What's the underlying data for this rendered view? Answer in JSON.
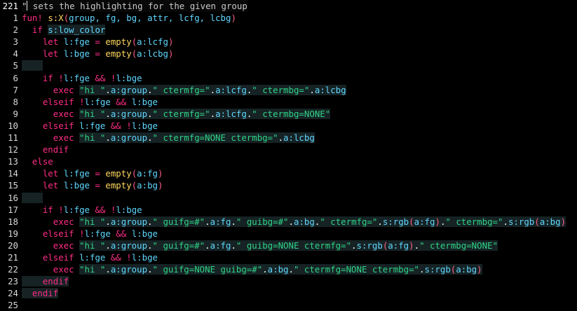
{
  "editor": {
    "current_line_number": "221",
    "colors": {
      "background": "#000000",
      "comment": "#c9c9c9",
      "keyword": "#ff2d86",
      "function": "#ffd75f",
      "variable": "#5fd7ff",
      "string": "#2ed486",
      "highlight_bg": "#162224"
    },
    "lines": [
      {
        "num": "221",
        "tokens": [
          {
            "t": "\"",
            "c": "c-comment"
          },
          {
            "t": " sets the highlighting for the given group",
            "c": "c-comment"
          }
        ]
      },
      {
        "num": "1",
        "tokens": [
          {
            "t": "fun! ",
            "c": "c-kw"
          },
          {
            "t": "s:X",
            "c": "c-fn"
          },
          {
            "t": "(",
            "c": "c-paren"
          },
          {
            "t": "group, fg, bg, attr, lcfg, lcbg",
            "c": "c-var"
          },
          {
            "t": ")",
            "c": "c-paren"
          }
        ]
      },
      {
        "num": "2",
        "tokens": [
          {
            "t": "  if ",
            "c": "c-kw"
          },
          {
            "t": "s:low_color",
            "c": "c-var",
            "hl": true
          }
        ]
      },
      {
        "num": "3",
        "tokens": [
          {
            "t": "    let ",
            "c": "c-kw"
          },
          {
            "t": "l:fge",
            "c": "c-var"
          },
          {
            "t": " = ",
            "c": "c-op"
          },
          {
            "t": "empty",
            "c": "c-fn"
          },
          {
            "t": "(",
            "c": "c-paren"
          },
          {
            "t": "a:lcfg",
            "c": "c-var"
          },
          {
            "t": ")",
            "c": "c-paren"
          }
        ]
      },
      {
        "num": "4",
        "tokens": [
          {
            "t": "    let ",
            "c": "c-kw"
          },
          {
            "t": "l:bge",
            "c": "c-var"
          },
          {
            "t": " = ",
            "c": "c-op"
          },
          {
            "t": "empty",
            "c": "c-fn"
          },
          {
            "t": "(",
            "c": "c-paren"
          },
          {
            "t": "a:lcbg",
            "c": "c-var"
          },
          {
            "t": ")",
            "c": "c-paren"
          }
        ]
      },
      {
        "num": "5",
        "tokens": [
          {
            "t": "    ",
            "c": "c-punc",
            "hl": true
          }
        ]
      },
      {
        "num": "6",
        "tokens": [
          {
            "t": "    if ",
            "c": "c-kw"
          },
          {
            "t": "!",
            "c": "c-op"
          },
          {
            "t": "l:fge",
            "c": "c-var"
          },
          {
            "t": " && ",
            "c": "c-op"
          },
          {
            "t": "!",
            "c": "c-op"
          },
          {
            "t": "l:bge",
            "c": "c-var"
          }
        ]
      },
      {
        "num": "7",
        "tokens": [
          {
            "t": "      exec ",
            "c": "c-kw"
          },
          {
            "t": "\"hi \"",
            "c": "c-str",
            "hl": true
          },
          {
            "t": ".",
            "c": "c-punc",
            "hl": true
          },
          {
            "t": "a:group",
            "c": "c-var",
            "hl": true
          },
          {
            "t": ".",
            "c": "c-punc",
            "hl": true
          },
          {
            "t": "\" ctermfg=\"",
            "c": "c-str",
            "hl": true
          },
          {
            "t": ".",
            "c": "c-punc",
            "hl": true
          },
          {
            "t": "a:lcfg",
            "c": "c-var",
            "hl": true
          },
          {
            "t": ".",
            "c": "c-punc",
            "hl": true
          },
          {
            "t": "\" ctermbg=\"",
            "c": "c-str",
            "hl": true
          },
          {
            "t": ".",
            "c": "c-punc",
            "hl": true
          },
          {
            "t": "a:lcbg",
            "c": "c-var",
            "hl": true
          }
        ]
      },
      {
        "num": "8",
        "tokens": [
          {
            "t": "    elseif ",
            "c": "c-kw"
          },
          {
            "t": "!",
            "c": "c-op"
          },
          {
            "t": "l:fge",
            "c": "c-var"
          },
          {
            "t": " && ",
            "c": "c-op"
          },
          {
            "t": "l:bge",
            "c": "c-var"
          }
        ]
      },
      {
        "num": "9",
        "tokens": [
          {
            "t": "      exec ",
            "c": "c-kw"
          },
          {
            "t": "\"hi \"",
            "c": "c-str",
            "hl": true
          },
          {
            "t": ".",
            "c": "c-punc",
            "hl": true
          },
          {
            "t": "a:group",
            "c": "c-var",
            "hl": true
          },
          {
            "t": ".",
            "c": "c-punc",
            "hl": true
          },
          {
            "t": "\" ctermfg=\"",
            "c": "c-str",
            "hl": true
          },
          {
            "t": ".",
            "c": "c-punc",
            "hl": true
          },
          {
            "t": "a:lcfg",
            "c": "c-var",
            "hl": true
          },
          {
            "t": ".",
            "c": "c-punc",
            "hl": true
          },
          {
            "t": "\" ctermbg=NONE\"",
            "c": "c-str",
            "hl": true
          }
        ]
      },
      {
        "num": "10",
        "tokens": [
          {
            "t": "    elseif ",
            "c": "c-kw"
          },
          {
            "t": "l:fge",
            "c": "c-var"
          },
          {
            "t": " && ",
            "c": "c-op"
          },
          {
            "t": "!",
            "c": "c-op"
          },
          {
            "t": "l:bge",
            "c": "c-var"
          }
        ]
      },
      {
        "num": "11",
        "tokens": [
          {
            "t": "      exec ",
            "c": "c-kw"
          },
          {
            "t": "\"hi \"",
            "c": "c-str",
            "hl": true
          },
          {
            "t": ".",
            "c": "c-punc",
            "hl": true
          },
          {
            "t": "a:group",
            "c": "c-var",
            "hl": true
          },
          {
            "t": ".",
            "c": "c-punc",
            "hl": true
          },
          {
            "t": "\" ctermfg=NONE ctermbg=\"",
            "c": "c-str",
            "hl": true
          },
          {
            "t": ".",
            "c": "c-punc",
            "hl": true
          },
          {
            "t": "a:lcbg",
            "c": "c-var",
            "hl": true
          }
        ]
      },
      {
        "num": "12",
        "tokens": [
          {
            "t": "    endif",
            "c": "c-kw"
          }
        ]
      },
      {
        "num": "13",
        "tokens": [
          {
            "t": "  else",
            "c": "c-kw"
          }
        ]
      },
      {
        "num": "14",
        "tokens": [
          {
            "t": "    let ",
            "c": "c-kw"
          },
          {
            "t": "l:fge",
            "c": "c-var"
          },
          {
            "t": " = ",
            "c": "c-op"
          },
          {
            "t": "empty",
            "c": "c-fn"
          },
          {
            "t": "(",
            "c": "c-paren"
          },
          {
            "t": "a:fg",
            "c": "c-var"
          },
          {
            "t": ")",
            "c": "c-paren"
          }
        ]
      },
      {
        "num": "15",
        "tokens": [
          {
            "t": "    let ",
            "c": "c-kw"
          },
          {
            "t": "l:bge",
            "c": "c-var"
          },
          {
            "t": " = ",
            "c": "c-op"
          },
          {
            "t": "empty",
            "c": "c-fn"
          },
          {
            "t": "(",
            "c": "c-paren"
          },
          {
            "t": "a:bg",
            "c": "c-var"
          },
          {
            "t": ")",
            "c": "c-paren"
          }
        ]
      },
      {
        "num": "16",
        "tokens": [
          {
            "t": "    ",
            "c": "c-punc",
            "hl": true
          }
        ]
      },
      {
        "num": "17",
        "tokens": [
          {
            "t": "    if ",
            "c": "c-kw"
          },
          {
            "t": "!",
            "c": "c-op"
          },
          {
            "t": "l:fge",
            "c": "c-var"
          },
          {
            "t": " && ",
            "c": "c-op"
          },
          {
            "t": "!",
            "c": "c-op"
          },
          {
            "t": "l:bge",
            "c": "c-var"
          }
        ]
      },
      {
        "num": "18",
        "tokens": [
          {
            "t": "      exec ",
            "c": "c-kw"
          },
          {
            "t": "\"hi \"",
            "c": "c-str",
            "hl": true
          },
          {
            "t": ".",
            "c": "c-punc",
            "hl": true
          },
          {
            "t": "a:group",
            "c": "c-var",
            "hl": true
          },
          {
            "t": ".",
            "c": "c-punc",
            "hl": true
          },
          {
            "t": "\" guifg=#\"",
            "c": "c-str",
            "hl": true
          },
          {
            "t": ".",
            "c": "c-punc",
            "hl": true
          },
          {
            "t": "a:fg",
            "c": "c-var",
            "hl": true
          },
          {
            "t": ".",
            "c": "c-punc",
            "hl": true
          },
          {
            "t": "\" guibg=#\"",
            "c": "c-str",
            "hl": true
          },
          {
            "t": ".",
            "c": "c-punc",
            "hl": true
          },
          {
            "t": "a:bg",
            "c": "c-var",
            "hl": true
          },
          {
            "t": ".",
            "c": "c-punc",
            "hl": true
          },
          {
            "t": "\" ctermfg=\"",
            "c": "c-str",
            "hl": true
          },
          {
            "t": ".",
            "c": "c-punc",
            "hl": true
          },
          {
            "t": "s:rgb",
            "c": "c-var",
            "hl": true
          },
          {
            "t": "(",
            "c": "c-paren",
            "hl": true
          },
          {
            "t": "a:fg",
            "c": "c-var",
            "hl": true
          },
          {
            "t": ")",
            "c": "c-paren",
            "hl": true
          },
          {
            "t": ".",
            "c": "c-punc",
            "hl": true
          },
          {
            "t": "\" ctermbg=\"",
            "c": "c-str",
            "hl": true
          },
          {
            "t": ".",
            "c": "c-punc",
            "hl": true
          },
          {
            "t": "s:rgb",
            "c": "c-var",
            "hl": true
          },
          {
            "t": "(",
            "c": "c-paren",
            "hl": true
          },
          {
            "t": "a:bg",
            "c": "c-var",
            "hl": true
          },
          {
            "t": ")",
            "c": "c-paren",
            "hl": true
          }
        ]
      },
      {
        "num": "19",
        "tokens": [
          {
            "t": "    elseif ",
            "c": "c-kw"
          },
          {
            "t": "!",
            "c": "c-op"
          },
          {
            "t": "l:fge",
            "c": "c-var"
          },
          {
            "t": " && ",
            "c": "c-op"
          },
          {
            "t": "l:bge",
            "c": "c-var"
          }
        ]
      },
      {
        "num": "20",
        "tokens": [
          {
            "t": "      exec ",
            "c": "c-kw"
          },
          {
            "t": "\"hi \"",
            "c": "c-str",
            "hl": true
          },
          {
            "t": ".",
            "c": "c-punc",
            "hl": true
          },
          {
            "t": "a:group",
            "c": "c-var",
            "hl": true
          },
          {
            "t": ".",
            "c": "c-punc",
            "hl": true
          },
          {
            "t": "\" guifg=#\"",
            "c": "c-str",
            "hl": true
          },
          {
            "t": ".",
            "c": "c-punc",
            "hl": true
          },
          {
            "t": "a:fg",
            "c": "c-var",
            "hl": true
          },
          {
            "t": ".",
            "c": "c-punc",
            "hl": true
          },
          {
            "t": "\" guibg=NONE ctermfg=\"",
            "c": "c-str",
            "hl": true
          },
          {
            "t": ".",
            "c": "c-punc",
            "hl": true
          },
          {
            "t": "s:rgb",
            "c": "c-var",
            "hl": true
          },
          {
            "t": "(",
            "c": "c-paren",
            "hl": true
          },
          {
            "t": "a:fg",
            "c": "c-var",
            "hl": true
          },
          {
            "t": ")",
            "c": "c-paren",
            "hl": true
          },
          {
            "t": ".",
            "c": "c-punc",
            "hl": true
          },
          {
            "t": "\" ctermbg=NONE\"",
            "c": "c-str",
            "hl": true
          }
        ]
      },
      {
        "num": "21",
        "tokens": [
          {
            "t": "    elseif ",
            "c": "c-kw"
          },
          {
            "t": "l:fge",
            "c": "c-var"
          },
          {
            "t": " && ",
            "c": "c-op"
          },
          {
            "t": "!",
            "c": "c-op"
          },
          {
            "t": "l:bge",
            "c": "c-var"
          }
        ]
      },
      {
        "num": "22",
        "tokens": [
          {
            "t": "      exec ",
            "c": "c-kw"
          },
          {
            "t": "\"hi \"",
            "c": "c-str",
            "hl": true
          },
          {
            "t": ".",
            "c": "c-punc",
            "hl": true
          },
          {
            "t": "a:group",
            "c": "c-var",
            "hl": true
          },
          {
            "t": ".",
            "c": "c-punc",
            "hl": true
          },
          {
            "t": "\" guifg=NONE guibg=#\"",
            "c": "c-str",
            "hl": true
          },
          {
            "t": ".",
            "c": "c-punc",
            "hl": true
          },
          {
            "t": "a:bg",
            "c": "c-var",
            "hl": true
          },
          {
            "t": ".",
            "c": "c-punc",
            "hl": true
          },
          {
            "t": "\" ctermfg=NONE ctermbg=\"",
            "c": "c-str",
            "hl": true
          },
          {
            "t": ".",
            "c": "c-punc",
            "hl": true
          },
          {
            "t": "s:rgb",
            "c": "c-var",
            "hl": true
          },
          {
            "t": "(",
            "c": "c-paren",
            "hl": true
          },
          {
            "t": "a:bg",
            "c": "c-var",
            "hl": true
          },
          {
            "t": ")",
            "c": "c-paren",
            "hl": true
          }
        ]
      },
      {
        "num": "23",
        "tokens": [
          {
            "t": "    endif",
            "c": "c-kw",
            "hl": true
          }
        ]
      },
      {
        "num": "24",
        "tokens": [
          {
            "t": "  endif",
            "c": "c-kw",
            "hl": true
          }
        ]
      },
      {
        "num": "25",
        "tokens": []
      }
    ]
  }
}
